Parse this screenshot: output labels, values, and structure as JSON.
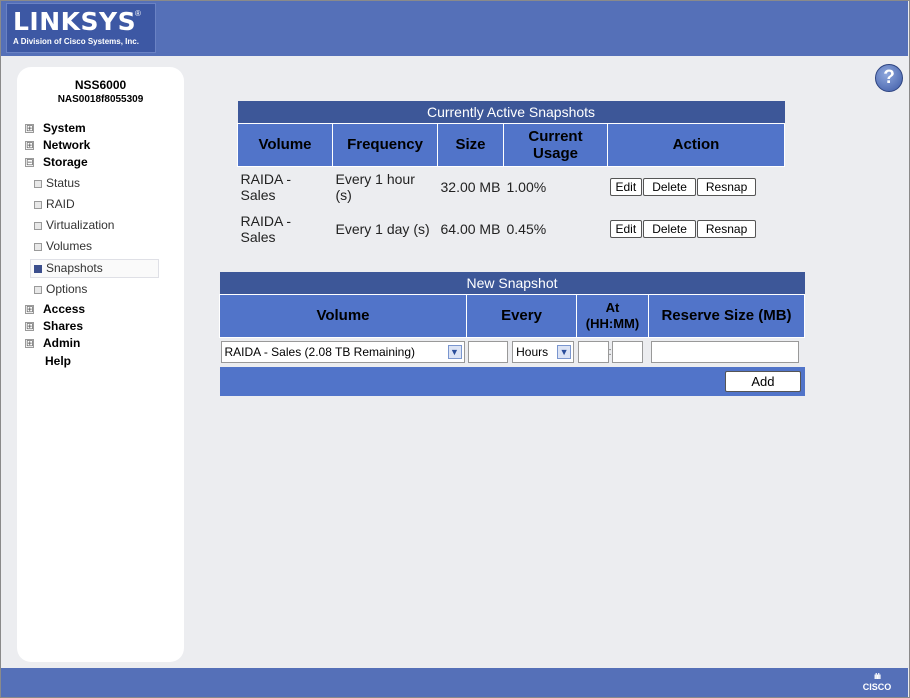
{
  "brand": {
    "logo": "LINKSYS",
    "registered": "®",
    "subtitle": "A Division of Cisco Systems, Inc.",
    "cisco_logo": "CISCO"
  },
  "device": {
    "model": "NSS6000",
    "id": "NAS0018f8055309"
  },
  "help_icon": "question-mark-icon",
  "nav": {
    "items": [
      {
        "label": "System",
        "expander": "⊞"
      },
      {
        "label": "Network",
        "expander": "⊞"
      },
      {
        "label": "Storage",
        "expander": "⊟"
      },
      {
        "label": "Access",
        "expander": "⊞"
      },
      {
        "label": "Shares",
        "expander": "⊞"
      },
      {
        "label": "Admin",
        "expander": "⊞"
      },
      {
        "label": "Help",
        "expander": ""
      }
    ],
    "storage_sub": [
      "Status",
      "RAID",
      "Virtualization",
      "Volumes",
      "Snapshots",
      "Options"
    ],
    "active_sub": "Snapshots"
  },
  "active_snapshots": {
    "title": "Currently Active Snapshots",
    "headers": [
      "Volume",
      "Frequency",
      "Size",
      "Current Usage",
      "Action"
    ],
    "rows": [
      {
        "volume": "RAIDA - Sales",
        "frequency": "Every 1 hour (s)",
        "size": "32.00 MB",
        "usage": "1.00%"
      },
      {
        "volume": "RAIDA - Sales",
        "frequency": "Every 1 day (s)",
        "size": "64.00 MB",
        "usage": "0.45%"
      }
    ],
    "actions": {
      "edit": "Edit",
      "delete": "Delete",
      "resnap": "Resnap"
    }
  },
  "new_snapshot": {
    "title": "New Snapshot",
    "headers": [
      "Volume",
      "Every",
      "At (HH:MM)",
      "Reserve Size (MB)"
    ],
    "volume_selected": "RAIDA - Sales (2.08 TB Remaining)",
    "every_value": "",
    "unit_selected": "Hours",
    "time_separator": ":",
    "add_label": "Add"
  },
  "colors": {
    "header_bar": "#5570b8",
    "table_title": "#3d5798",
    "table_header": "#5174c9",
    "content_bg": "#ecedf0"
  }
}
